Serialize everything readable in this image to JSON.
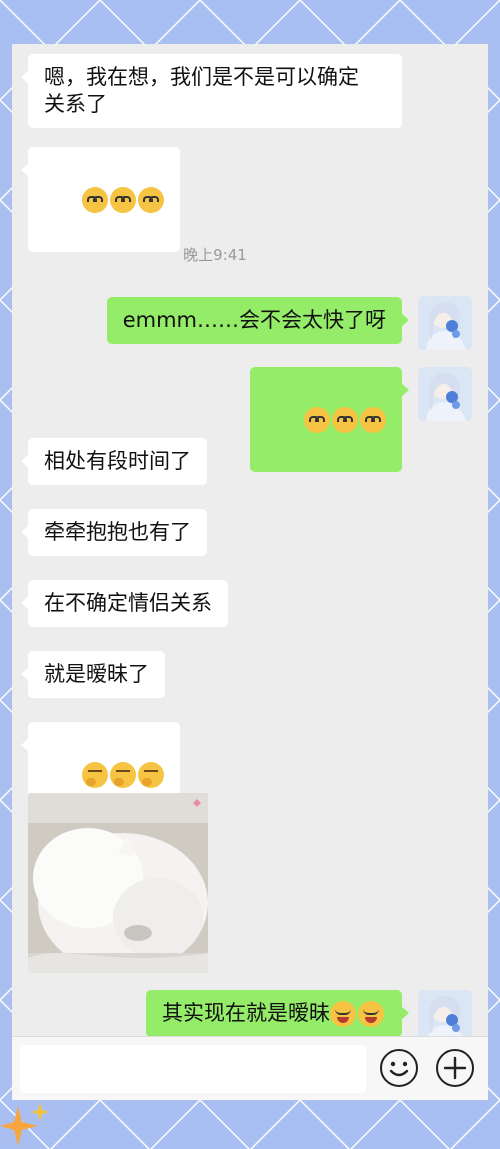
{
  "messages": [
    {
      "side": "left",
      "text": "嗯，我在想，我们是不是可以确定\n关系了"
    },
    {
      "side": "left",
      "emoji": "cat-emoji",
      "count": 3
    },
    {
      "side": "right",
      "text": "emmm……会不会太快了呀"
    },
    {
      "side": "right",
      "emoji": "cat-emoji",
      "count": 3
    },
    {
      "side": "left",
      "text": "相处有段时间了"
    },
    {
      "side": "left",
      "text": "牵牵抱抱也有了"
    },
    {
      "side": "left",
      "text": "在不确定情侣关系"
    },
    {
      "side": "left",
      "text": "就是暧昧了"
    },
    {
      "side": "left",
      "emoji": "thinking-emoji",
      "count": 3
    },
    {
      "side": "left",
      "image": "white-dog-photo"
    },
    {
      "side": "right",
      "text": "其实现在就是暧昧",
      "emoji": "laughing-crying-emoji",
      "count": 2
    }
  ],
  "timestamp": "晚上9:41",
  "input": {
    "placeholder": "",
    "emoji_button_icon": "smile-icon",
    "more_button_icon": "plus-icon"
  },
  "colors": {
    "background": "#a9bff2",
    "chat_bg": "#ededed",
    "bubble_left": "#ffffff",
    "bubble_right": "#95ec69"
  }
}
